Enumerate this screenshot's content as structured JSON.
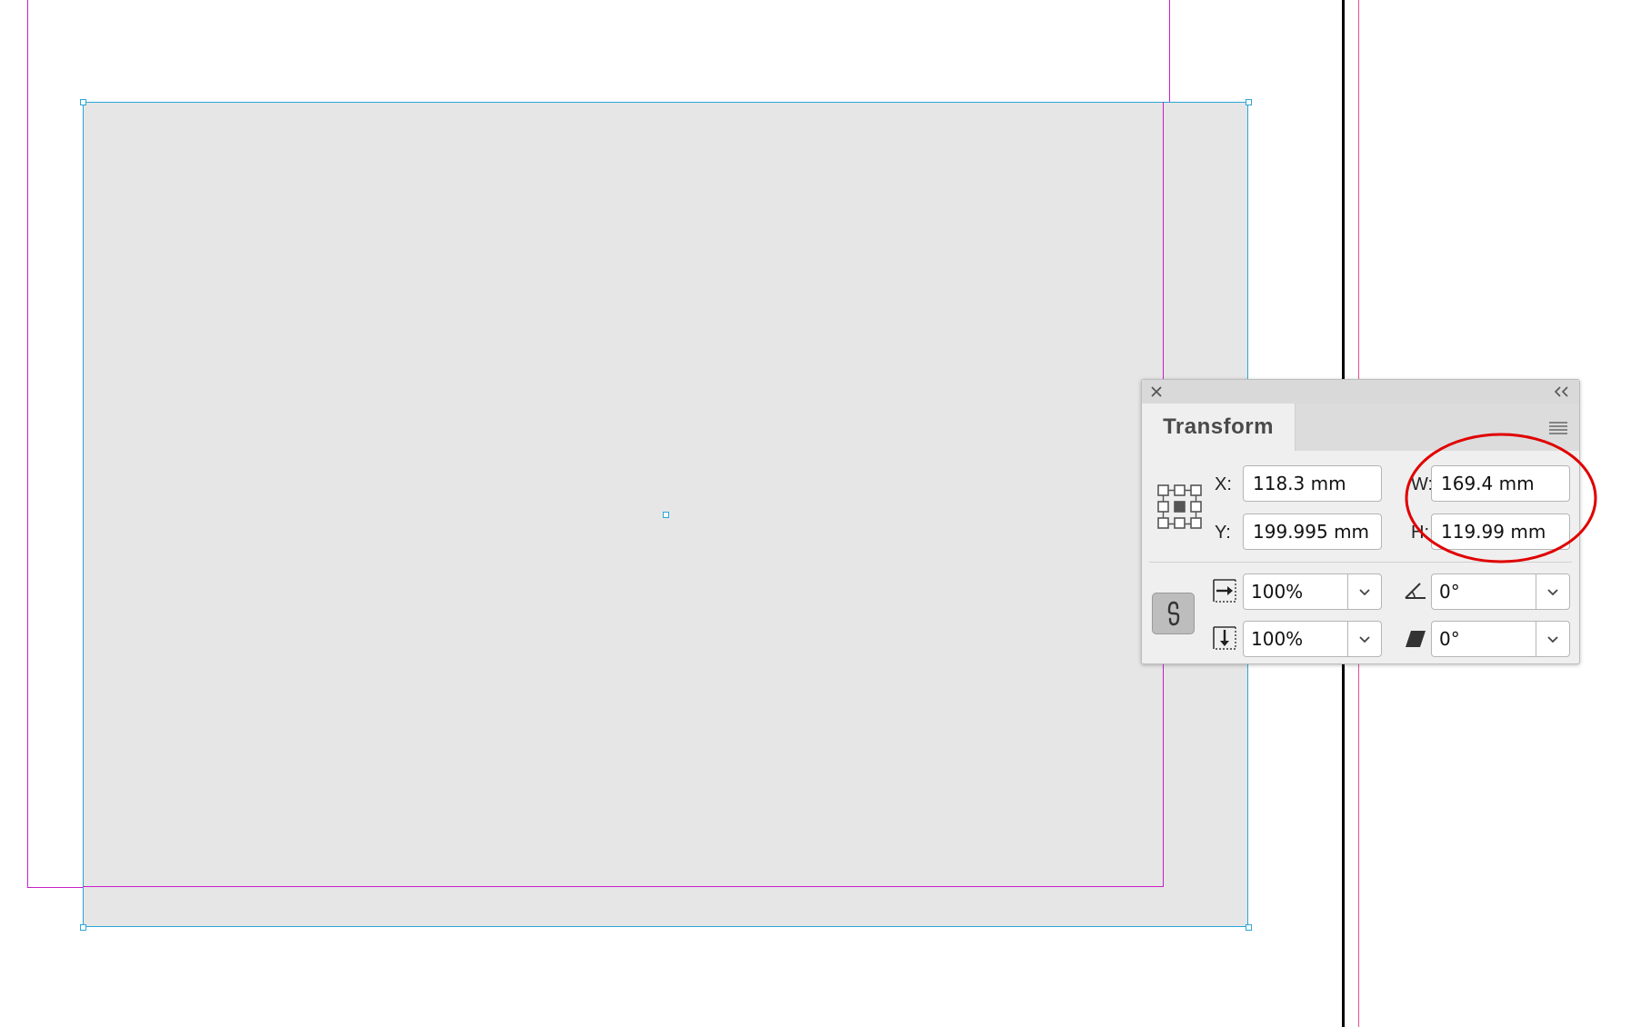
{
  "panel": {
    "title": "Transform",
    "close_icon": "close-icon",
    "collapse_icon": "collapse-icon",
    "menu_icon": "panel-menu-icon",
    "reference_point_icon": "reference-point-icon",
    "x_label": "X:",
    "x_value": "118.3 mm",
    "y_label": "Y:",
    "y_value": "199.995 mm",
    "w_label": "W:",
    "w_value": "169.4 mm",
    "h_label": "H:",
    "h_value": "119.99 mm",
    "scale_x_value": "100%",
    "scale_y_value": "100%",
    "rotation_value": "0°",
    "shear_value": "0°",
    "constrain_icon": "link-icon",
    "scale_x_icon": "scale-x-icon",
    "scale_y_icon": "scale-y-icon",
    "rotation_icon": "rotation-angle-icon",
    "shear_icon": "shear-angle-icon"
  },
  "annotation": {
    "color": "#e00000"
  },
  "colors": {
    "frame_fill": "#e6e6e6",
    "selection": "#2aa6d8",
    "margin_guide": "#c81ec8"
  }
}
